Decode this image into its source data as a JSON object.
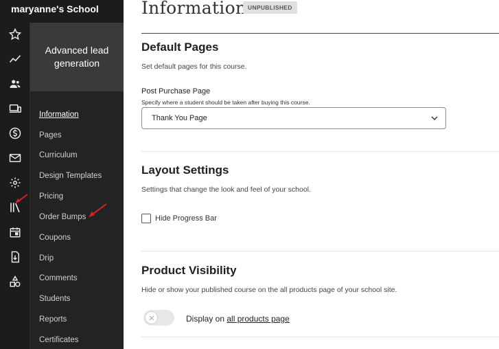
{
  "school": {
    "name": "maryanne's School"
  },
  "rail": {
    "icons": [
      "star-icon",
      "chart-line-icon",
      "users-icon",
      "devices-icon",
      "dollar-icon",
      "mail-icon",
      "gear-icon",
      "library-icon",
      "calendar-icon",
      "download-icon",
      "shapes-icon"
    ]
  },
  "course": {
    "title": "Advanced lead generation",
    "nav": [
      {
        "label": "Information",
        "active": true
      },
      {
        "label": "Pages"
      },
      {
        "label": "Curriculum"
      },
      {
        "label": "Design Templates"
      },
      {
        "label": "Pricing"
      },
      {
        "label": "Order Bumps"
      },
      {
        "label": "Coupons"
      },
      {
        "label": "Drip"
      },
      {
        "label": "Comments"
      },
      {
        "label": "Students"
      },
      {
        "label": "Reports"
      },
      {
        "label": "Certificates"
      }
    ]
  },
  "main": {
    "title": "Information",
    "status": "UNPUBLISHED",
    "default_pages": {
      "heading": "Default Pages",
      "description": "Set default pages for this course.",
      "field_label": "Post Purchase Page",
      "field_help": "Specify where a student should be taken after buying this course.",
      "selected": "Thank You Page"
    },
    "layout": {
      "heading": "Layout Settings",
      "description": "Settings that change the look and feel of your school.",
      "checkbox_label": "Hide Progress Bar",
      "checked": false
    },
    "visibility": {
      "heading": "Product Visibility",
      "description": "Hide or show your published course on the all products page of your school site.",
      "toggle_prefix": "Display on",
      "toggle_link": "all products page",
      "enabled": false
    }
  },
  "annotation_color": "#e02020"
}
